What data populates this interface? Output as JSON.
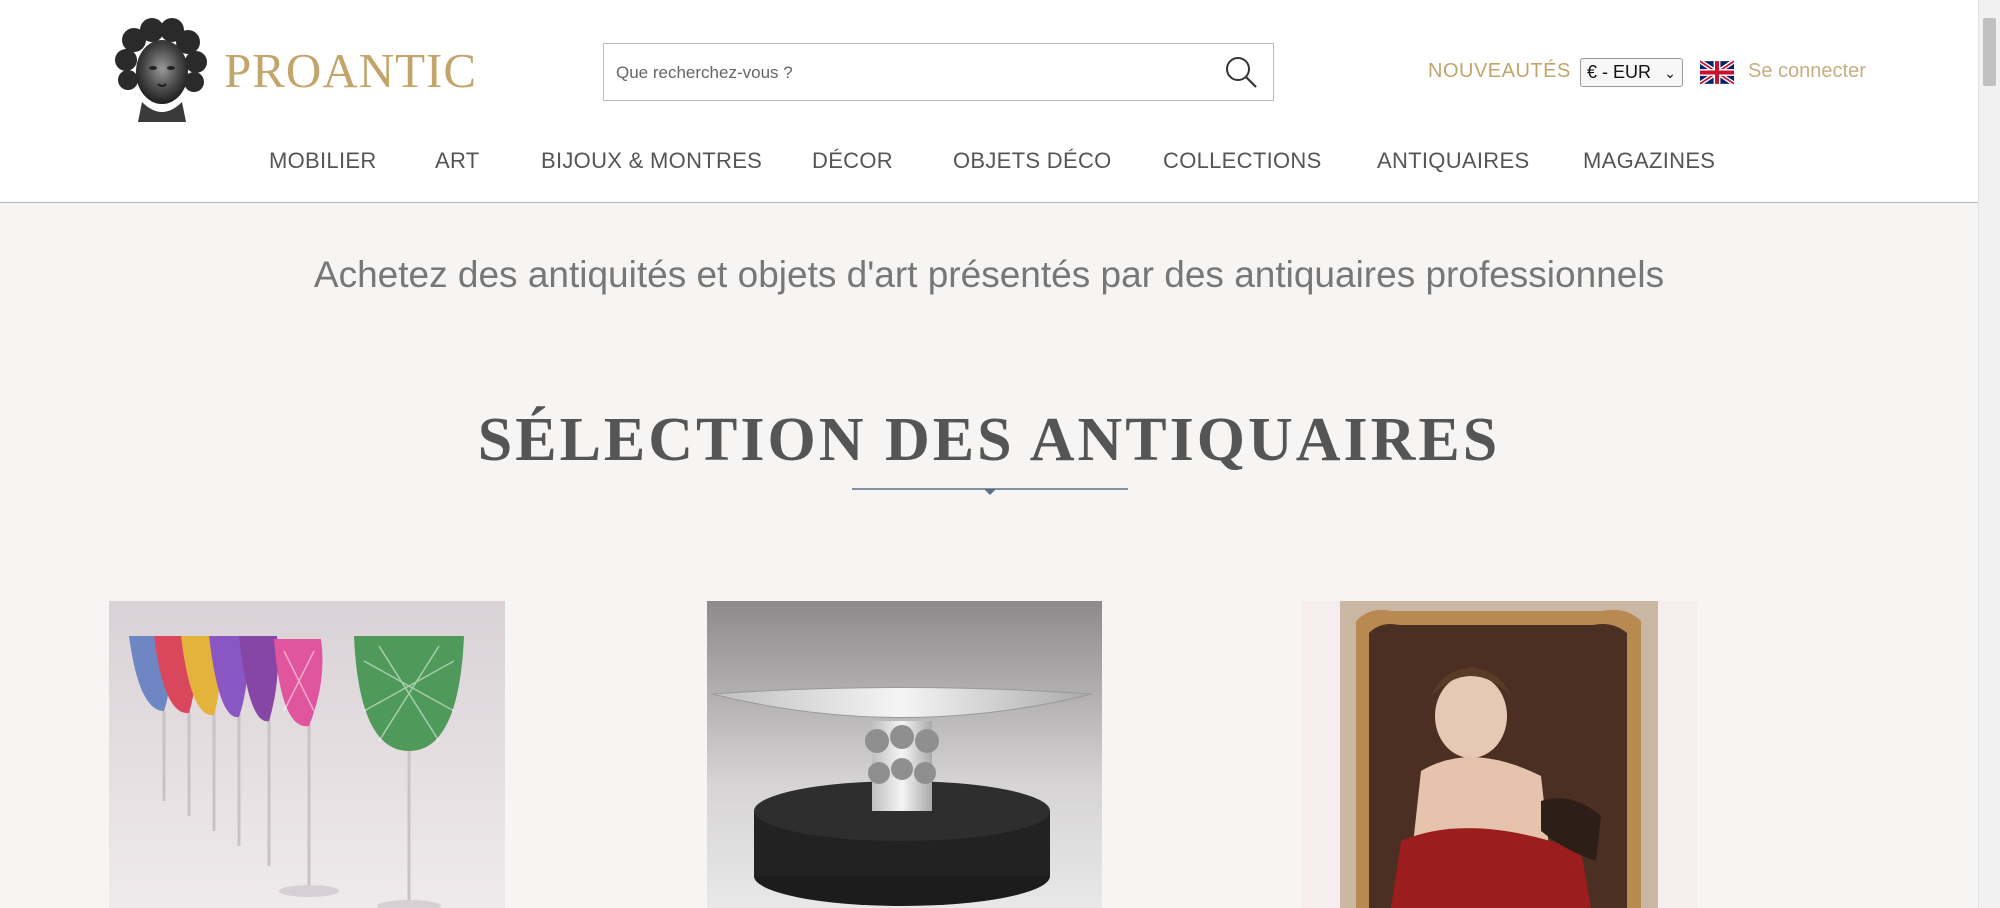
{
  "header": {
    "logo_text": "PROANTIC",
    "search": {
      "placeholder": "Que recherchez-vous ?",
      "value": ""
    },
    "nouveautes_label": "NOUVEAUTÉS",
    "currency_selected": "€ - EUR",
    "language_flag": "uk-flag-icon",
    "login_label": "Se connecter"
  },
  "nav": {
    "items": [
      {
        "label": "MOBILIER"
      },
      {
        "label": "ART"
      },
      {
        "label": "BIJOUX & MONTRES"
      },
      {
        "label": "DÉCOR"
      },
      {
        "label": "OBJETS DÉCO"
      },
      {
        "label": "COLLECTIONS"
      },
      {
        "label": "ANTIQUAIRES"
      },
      {
        "label": "MAGAZINES"
      }
    ]
  },
  "main": {
    "tagline": "Achetez des antiquités et objets d'art présentés par des antiquaires professionnels",
    "section_title": "SÉLECTION DES ANTIQUAIRES",
    "products": [
      {
        "image": "colored-crystal-wine-glasses"
      },
      {
        "image": "silver-centerpiece-dish"
      },
      {
        "image": "portrait-painting-child"
      }
    ]
  },
  "colors": {
    "accent_gold": "#c2a56a",
    "login_gold": "#c7ae82",
    "text_gray": "#555555",
    "background": "#f7f5f4"
  }
}
